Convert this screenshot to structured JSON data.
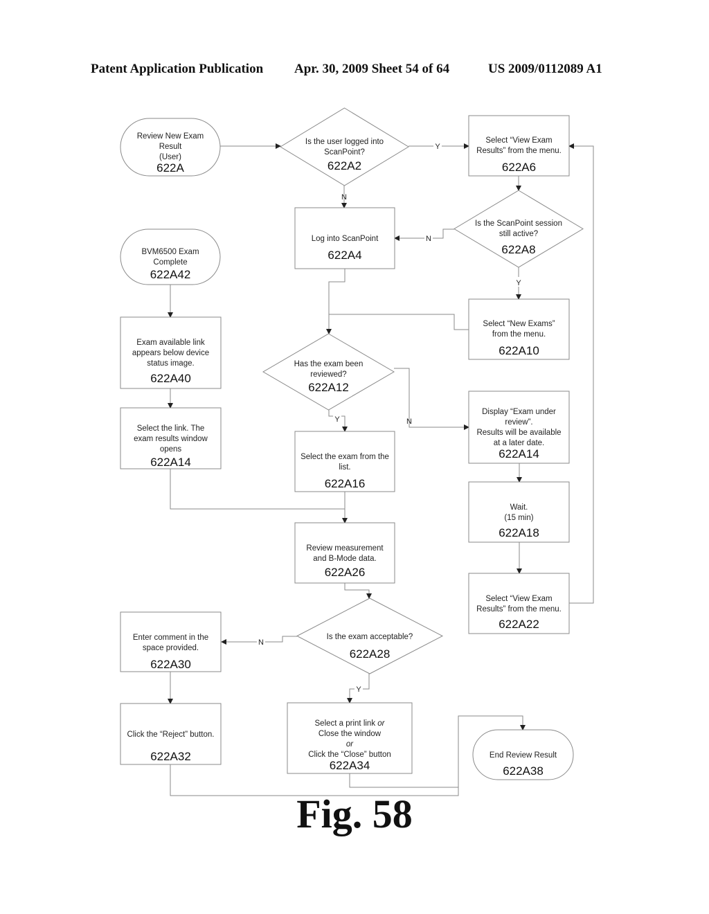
{
  "header": {
    "publication": "Patent Application Publication",
    "date_sheet": "Apr. 30, 2009  Sheet 54 of 64",
    "patent_number": "US 2009/0112089 A1"
  },
  "figure_label": "Fig. 58",
  "nodes": {
    "n622A": {
      "type": "terminal",
      "lines": [
        "Review New Exam",
        "Result",
        "(User)"
      ],
      "id": "622A"
    },
    "n622A2": {
      "type": "decision",
      "lines": [
        "Is the user logged into",
        "ScanPoint?"
      ],
      "id": "622A2"
    },
    "n622A6": {
      "type": "process",
      "lines": [
        "Select “View Exam",
        "Results” from the menu."
      ],
      "id": "622A6"
    },
    "n622A8": {
      "type": "decision",
      "lines": [
        "Is the ScanPoint session",
        "still active?"
      ],
      "id": "622A8"
    },
    "n622A4": {
      "type": "process",
      "lines": [
        "Log into ScanPoint"
      ],
      "id": "622A4"
    },
    "n622A42": {
      "type": "terminal",
      "lines": [
        "BVM6500 Exam",
        "Complete"
      ],
      "id": "622A42"
    },
    "n622A10": {
      "type": "process",
      "lines": [
        "Select “New Exams”",
        "from the menu."
      ],
      "id": "622A10"
    },
    "n622A40": {
      "type": "process",
      "lines": [
        "Exam available link",
        "appears below device",
        "status image."
      ],
      "id": "622A40"
    },
    "n622A12": {
      "type": "decision",
      "lines": [
        "Has the exam been",
        "reviewed?"
      ],
      "id": "622A12"
    },
    "n622A14a": {
      "type": "process",
      "lines": [
        "Display “Exam under",
        "review”.",
        "Results will be available",
        "at a later date."
      ],
      "id": "622A14"
    },
    "n622A14b": {
      "type": "process",
      "lines": [
        "Select the link. The",
        "exam results window",
        "opens"
      ],
      "id": "622A14"
    },
    "n622A16": {
      "type": "process",
      "lines": [
        "Select the exam from the",
        "list."
      ],
      "id": "622A16"
    },
    "n622A18": {
      "type": "process",
      "lines": [
        "Wait.",
        "(15 min)"
      ],
      "id": "622A18"
    },
    "n622A26": {
      "type": "process",
      "lines": [
        "Review measurement",
        "and B-Mode data."
      ],
      "id": "622A26"
    },
    "n622A22": {
      "type": "process",
      "lines": [
        "Select “View Exam",
        "Results” from the menu."
      ],
      "id": "622A22"
    },
    "n622A30": {
      "type": "process",
      "lines": [
        "Enter comment in the",
        "space provided."
      ],
      "id": "622A30"
    },
    "n622A28": {
      "type": "decision",
      "lines": [
        "Is the exam acceptable?"
      ],
      "id": "622A28"
    },
    "n622A32": {
      "type": "process",
      "lines": [
        "Click the “Reject” button."
      ],
      "id": "622A32"
    },
    "n622A34": {
      "type": "process",
      "lines": [
        "Select a print link or",
        "Close the window",
        "or",
        "Click the “Close” button"
      ],
      "id": "622A34"
    },
    "n622A38": {
      "type": "terminal",
      "lines": [
        "End Review Result"
      ],
      "id": "622A38"
    }
  },
  "edge_labels": {
    "a2_yes": "Y",
    "a2_no": "N",
    "a8_no": "N",
    "a8_yes": "Y",
    "a12_yes": "Y",
    "a12_no": "N",
    "a28_no": "N",
    "a28_yes": "Y"
  }
}
